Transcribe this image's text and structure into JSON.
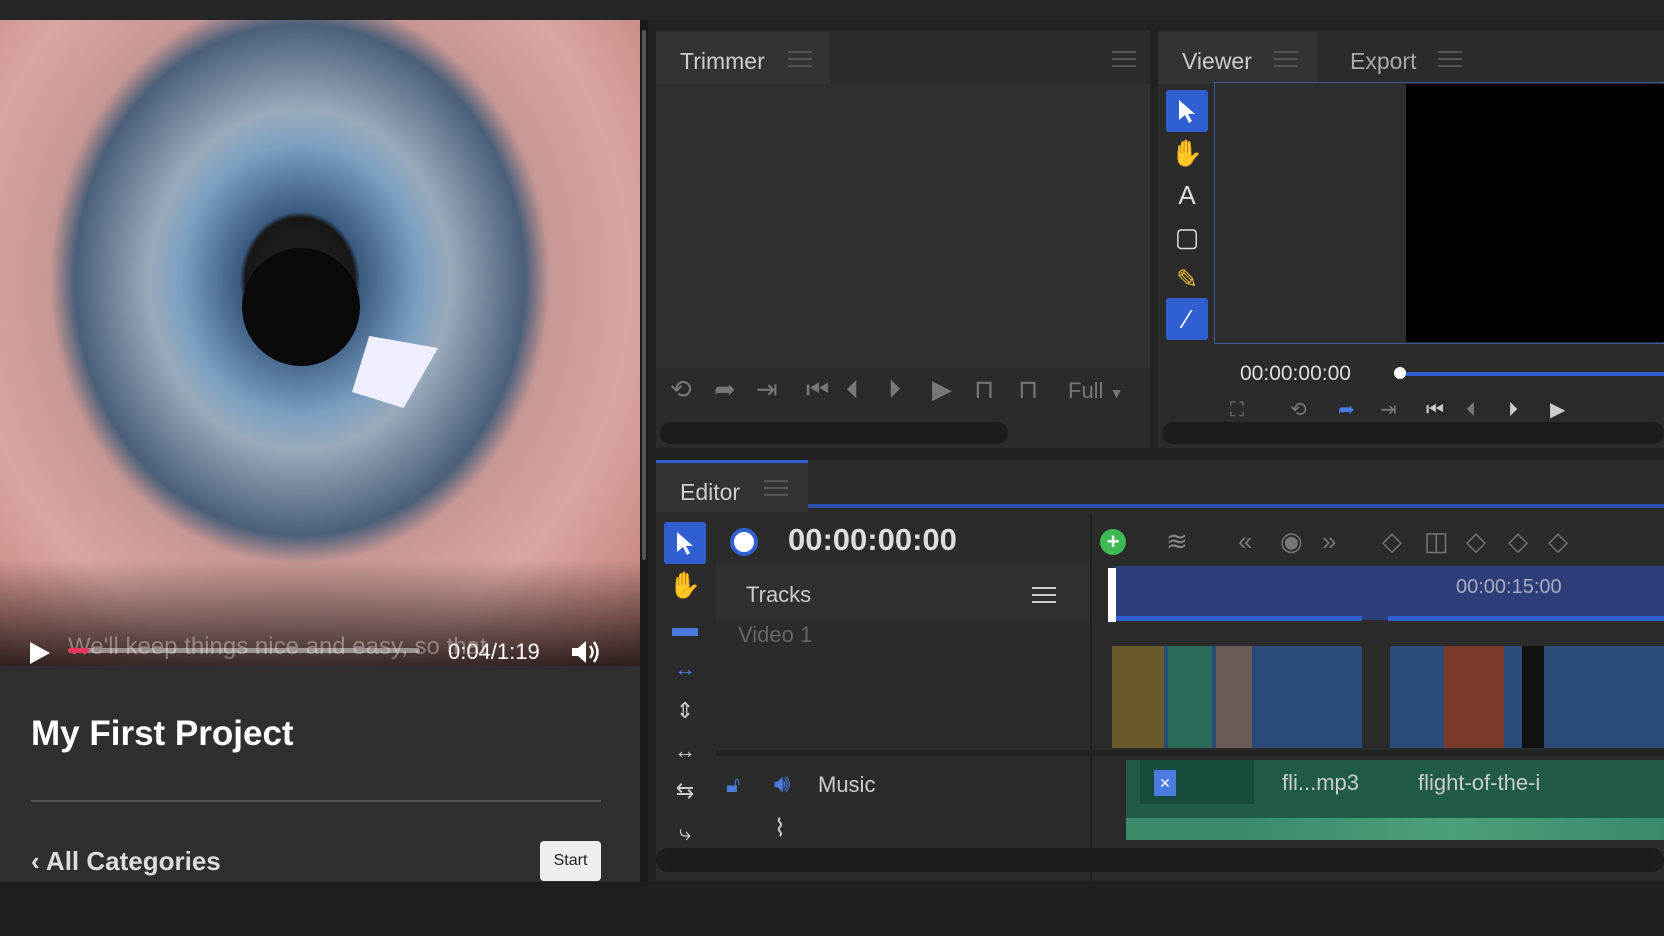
{
  "video": {
    "caption": "We'll keep things nice and easy, so that",
    "time": "0:04/1:19",
    "progress": 0.06
  },
  "project": {
    "title": "My First Project",
    "back_label": "All Categories",
    "start_label": "Start"
  },
  "trimmer": {
    "tab_label": "Trimmer",
    "zoom": "Full"
  },
  "viewer": {
    "tab_label": "Viewer",
    "export_tab": "Export",
    "timecode": "00:00:00:00"
  },
  "editor": {
    "tab_label": "Editor",
    "timecode": "00:00:00:00",
    "tracks_label": "Tracks",
    "ruler_time": "00:00:15:00",
    "track_video": "Video 1",
    "track_music": "Music",
    "clip1": "fli...mp3",
    "clip2": "flight-of-the-i"
  },
  "colors": {
    "accent": "#2f5fd0",
    "seek": "#e8375a",
    "add": "#3cba54",
    "music_clip": "#1f5a4a"
  }
}
